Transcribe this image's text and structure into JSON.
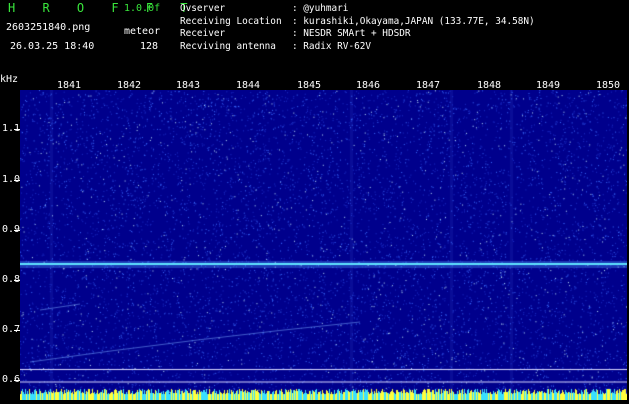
{
  "header": {
    "app_title": "H R O F F T",
    "version": "1.0.0f",
    "file_name": "2603251840.png",
    "mode": "meteor",
    "date": "26.03.25 18:40",
    "count": "128"
  },
  "station_info": [
    {
      "key": "Ovserver",
      "value": ": @yuhmari"
    },
    {
      "key": "Receiving Location",
      "value": ": kurashiki,Okayama,JAPAN (133.77E, 34.58N)"
    },
    {
      "key": "Receiver",
      "value": ": NESDR SMArt + HDSDR"
    },
    {
      "key": "Recviving antenna",
      "value": ": Radix RV-62V"
    }
  ],
  "chart_data": {
    "type": "heatmap",
    "ylabel": "kHz",
    "y_ticks": [
      "1.1",
      "1.0",
      "0.9",
      "0.8",
      "0.7",
      "0.6"
    ],
    "x_ticks": [
      "1841",
      "1842",
      "1843",
      "1844",
      "1845",
      "1846",
      "1847",
      "1848",
      "1849",
      "1850"
    ],
    "carrier_khz": 0.83,
    "colors": {
      "background": "#00008c",
      "noise": "#3a6cff",
      "carrier": "#5fe3ff",
      "bottom_bar": "#ffff3c"
    }
  }
}
